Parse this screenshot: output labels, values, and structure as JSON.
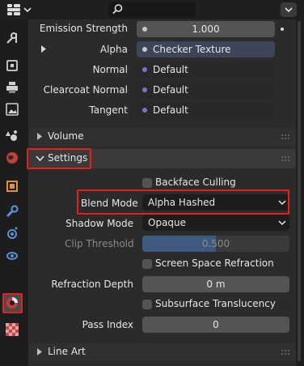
{
  "header": {
    "editor_type_icon": "properties-editor-icon",
    "search_placeholder": "",
    "options_icon": "chevron-down-icon"
  },
  "tabs": [
    {
      "name": "tool",
      "icon": "wrench-screwdriver-icon"
    },
    {
      "name": "render",
      "icon": "camera-back-icon"
    },
    {
      "name": "output",
      "icon": "printer-icon"
    },
    {
      "name": "view-layer",
      "icon": "image-icon"
    },
    {
      "name": "scene",
      "icon": "scene-cone-sphere-icon"
    },
    {
      "name": "world",
      "icon": "globe-icon"
    },
    {
      "name": "object",
      "icon": "orange-square-icon"
    },
    {
      "name": "modifiers",
      "icon": "wrench-icon"
    },
    {
      "name": "particles",
      "icon": "particles-icon"
    },
    {
      "name": "physics",
      "icon": "physics-orbit-icon"
    },
    {
      "name": "material",
      "icon": "material-sphere-icon",
      "active": true
    },
    {
      "name": "texture",
      "icon": "checker-texture-icon"
    }
  ],
  "surface": {
    "emission_strength": {
      "label": "Emission Strength",
      "value": "1.000"
    },
    "alpha": {
      "label": "Alpha",
      "value": "Checker Texture"
    },
    "normal": {
      "label": "Normal",
      "value": "Default"
    },
    "clearcoat_normal": {
      "label": "Clearcoat Normal",
      "value": "Default"
    },
    "tangent": {
      "label": "Tangent",
      "value": "Default"
    }
  },
  "sections": {
    "volume": "Volume",
    "settings": "Settings",
    "line_art": "Line Art"
  },
  "settings": {
    "backface_culling": {
      "label": "Backface Culling",
      "checked": false
    },
    "blend_mode": {
      "label": "Blend Mode",
      "value": "Alpha Hashed"
    },
    "shadow_mode": {
      "label": "Shadow Mode",
      "value": "Opaque"
    },
    "clip_threshold": {
      "label": "Clip Threshold",
      "value": "0.500",
      "fill_fraction": 0.5
    },
    "screen_space_refraction": {
      "label": "Screen Space Refraction",
      "checked": false
    },
    "refraction_depth": {
      "label": "Refraction Depth",
      "value": "0 m"
    },
    "subsurface_translucency": {
      "label": "Subsurface Translucency",
      "checked": false
    },
    "pass_index": {
      "label": "Pass Index",
      "value": "0"
    }
  },
  "colors": {
    "highlight_red": "#e3221c",
    "socket_purple": "#7a73d6",
    "socket_gray": "#c7c7c7",
    "slider_blue": "#4772b3"
  }
}
